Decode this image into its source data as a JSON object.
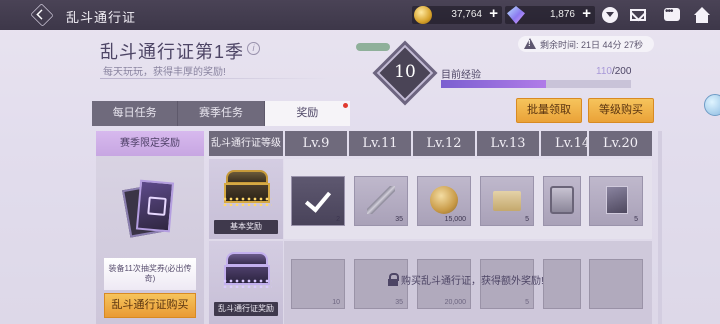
{
  "topbar": {
    "title": "乱斗通行证",
    "gold": {
      "value": "37,764",
      "icon": "gold-coin-icon"
    },
    "gems": {
      "value": "1,876",
      "icon": "gem-icon"
    }
  },
  "header": {
    "title": "乱斗通行证第1季",
    "subtitle": "每天玩玩，获得丰厚的奖励!",
    "timer_text": "剩余时间: 21日 44分 27秒"
  },
  "level": {
    "current": "10",
    "xp_label": "目前经验",
    "xp_current": "110",
    "xp_total": "/200",
    "xp_fraction": 0.55
  },
  "buttons": {
    "claim_all": "批量领取",
    "buy_levels": "等级购买"
  },
  "tabs": [
    {
      "label": "每日任务",
      "active": false
    },
    {
      "label": "赛季任务",
      "active": false
    },
    {
      "label": "奖励",
      "active": true,
      "badge": true
    }
  ],
  "season_reward": {
    "header": "赛季限定奖励",
    "caption": "装备11次抽奖券(必出传奇)",
    "buy_button": "乱斗通行证购买"
  },
  "table": {
    "tier_header": "乱斗通行证等级",
    "levels": [
      "Lv.9",
      "Lv.11",
      "Lv.12",
      "Lv.13",
      "Lv.14",
      "Lv.20"
    ],
    "basic_label": "基本奖励",
    "premium_label": "乱斗通行证奖励",
    "basic_items": [
      {
        "icon": "claimed-check-icon",
        "qty": "2",
        "claimed": true
      },
      {
        "icon": "feather-icon",
        "qty": "35",
        "claimed": false
      },
      {
        "icon": "coin-icon",
        "qty": "15,000",
        "claimed": false
      },
      {
        "icon": "ticket-icon",
        "qty": "5",
        "claimed": false
      },
      {
        "icon": "supply-box-icon",
        "qty": "",
        "claimed": false
      },
      {
        "icon": "card-icon",
        "qty": "5",
        "claimed": false
      }
    ],
    "premium_items": [
      {
        "icon": "box-icon",
        "qty": "10"
      },
      {
        "icon": "feather-icon",
        "qty": "35"
      },
      {
        "icon": "coin-icon",
        "qty": "20,000"
      },
      {
        "icon": "ticket-icon",
        "qty": "5"
      },
      {
        "icon": "box-icon",
        "qty": ""
      },
      {
        "icon": "card-icon",
        "qty": ""
      }
    ],
    "locked_text": "购买乱斗通行证，获得额外奖励!"
  }
}
